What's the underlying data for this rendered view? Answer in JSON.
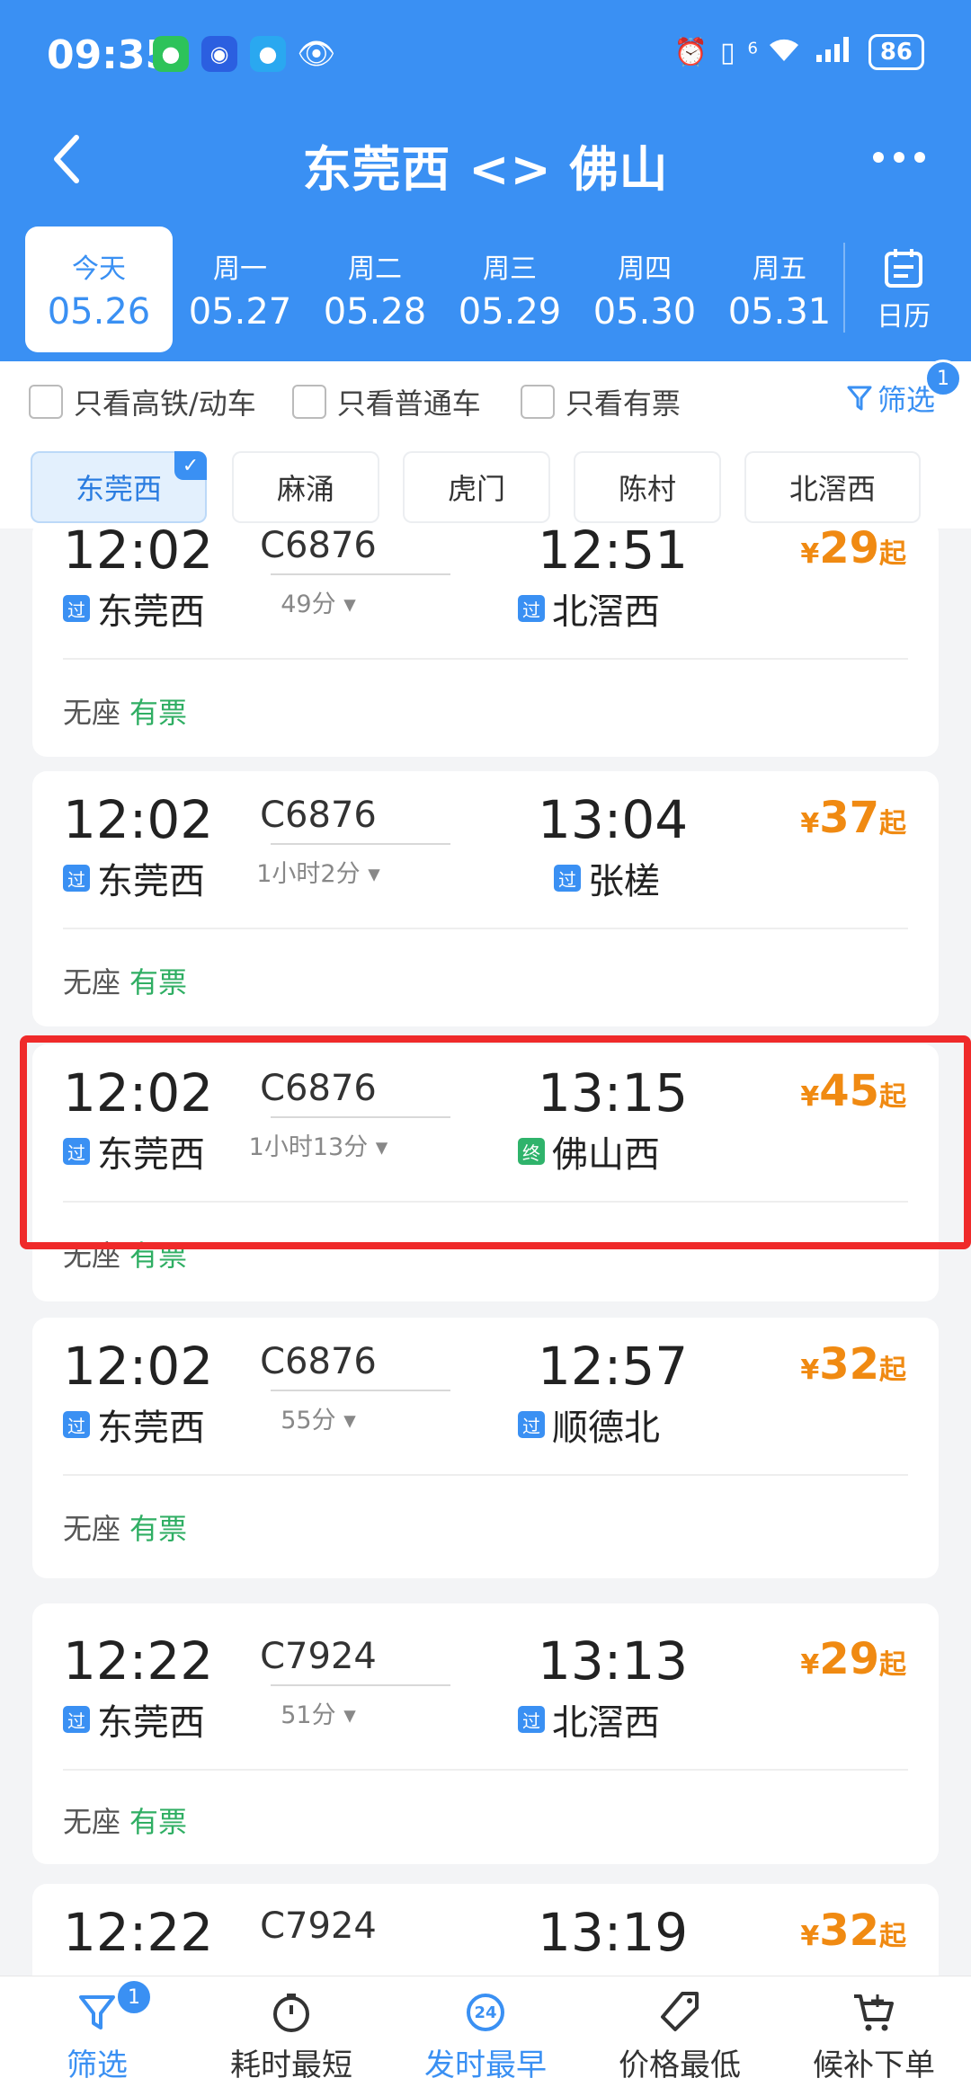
{
  "status_bar": {
    "time": "09:35",
    "battery": "86",
    "signal_label": "6"
  },
  "nav": {
    "title": "东莞西 <> 佛山"
  },
  "dates": [
    {
      "weekday": "今天",
      "date": "05.26",
      "active": true
    },
    {
      "weekday": "周一",
      "date": "05.27"
    },
    {
      "weekday": "周二",
      "date": "05.28"
    },
    {
      "weekday": "周三",
      "date": "05.29"
    },
    {
      "weekday": "周四",
      "date": "05.30"
    },
    {
      "weekday": "周五",
      "date": "05.31"
    }
  ],
  "calendar_label": "日历",
  "filters": {
    "high_speed_only": "只看高铁/动车",
    "normal_only": "只看普通车",
    "tickets_only": "只看有票",
    "filter_label": "筛选",
    "filter_count": "1"
  },
  "stations": [
    "东莞西",
    "麻涌",
    "虎门",
    "陈村",
    "北滘西"
  ],
  "trains": [
    {
      "dep": "12:02",
      "no": "C6876",
      "arr": "12:51",
      "duration": "49分",
      "from": "东莞西",
      "from_tag": "过",
      "to": "北滘西",
      "to_tag": "过",
      "price": "29",
      "yen": "¥",
      "qi": "起",
      "seat": "无座",
      "avail": "有票"
    },
    {
      "dep": "12:02",
      "no": "C6876",
      "arr": "13:04",
      "duration": "1小时2分",
      "from": "东莞西",
      "from_tag": "过",
      "to": "张槎",
      "to_tag": "过",
      "price": "37",
      "yen": "¥",
      "qi": "起",
      "seat": "无座",
      "avail": "有票"
    },
    {
      "dep": "12:02",
      "no": "C6876",
      "arr": "13:15",
      "duration": "1小时13分",
      "from": "东莞西",
      "from_tag": "过",
      "to": "佛山西",
      "to_tag": "终",
      "price": "45",
      "yen": "¥",
      "qi": "起",
      "seat": "无座",
      "avail": "有票"
    },
    {
      "dep": "12:02",
      "no": "C6876",
      "arr": "12:57",
      "duration": "55分",
      "from": "东莞西",
      "from_tag": "过",
      "to": "顺德北",
      "to_tag": "过",
      "price": "32",
      "yen": "¥",
      "qi": "起",
      "seat": "无座",
      "avail": "有票"
    },
    {
      "dep": "12:22",
      "no": "C7924",
      "arr": "13:13",
      "duration": "51分",
      "from": "东莞西",
      "from_tag": "过",
      "to": "北滘西",
      "to_tag": "过",
      "price": "29",
      "yen": "¥",
      "qi": "起",
      "seat": "无座",
      "avail": "有票"
    },
    {
      "dep": "12:22",
      "no": "C7924",
      "arr": "13:19",
      "duration": "",
      "from": "",
      "from_tag": "",
      "to": "",
      "to_tag": "",
      "price": "32",
      "yen": "¥",
      "qi": "起",
      "seat": "",
      "avail": ""
    }
  ],
  "bottom_bar": [
    {
      "label": "筛选",
      "icon": "filter-icon",
      "badge": "1",
      "active": true
    },
    {
      "label": "耗时最短",
      "icon": "timer-icon"
    },
    {
      "label": "发时最早",
      "icon": "clock-24-icon",
      "icon_text": "24",
      "active": true
    },
    {
      "label": "价格最低",
      "icon": "price-tag-icon"
    },
    {
      "label": "候补下单",
      "icon": "cart-icon"
    }
  ],
  "colors": {
    "brand": "#3a90f3",
    "price": "#f08a12",
    "available": "#2fae63",
    "highlight": "#ef2a2a"
  }
}
